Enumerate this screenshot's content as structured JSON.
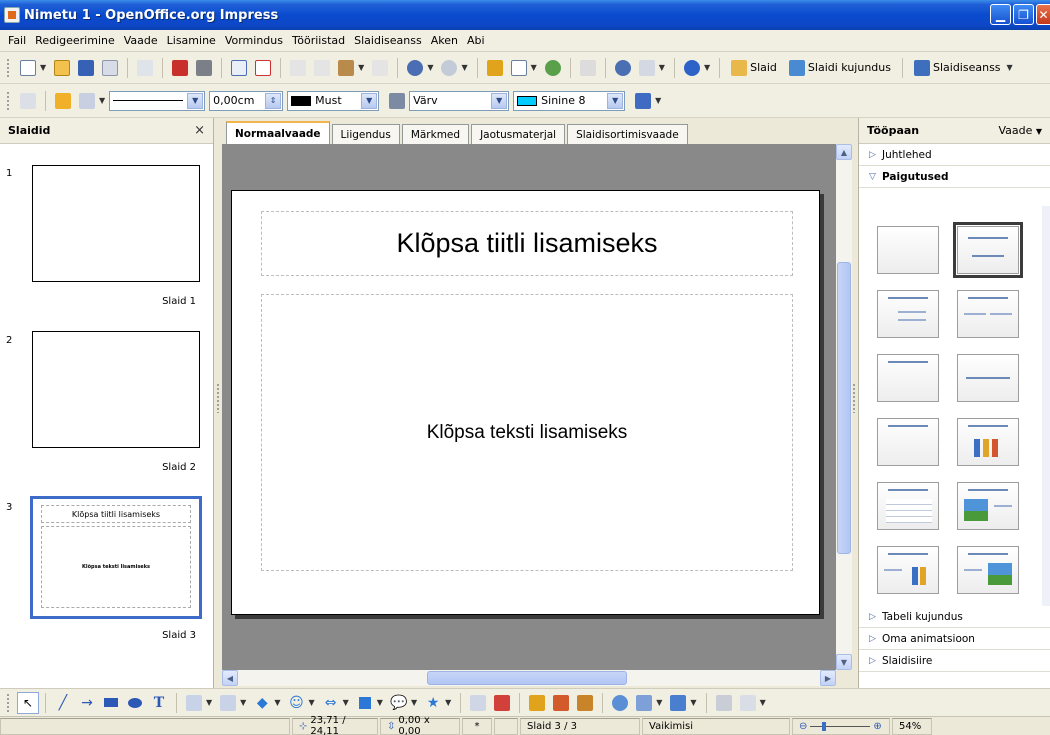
{
  "window": {
    "title": "Nimetu 1 - OpenOffice.org Impress"
  },
  "menu": [
    "Fail",
    "Redigeerimine",
    "Vaade",
    "Lisamine",
    "Vormindus",
    "Tööriistad",
    "Slaidiseanss",
    "Aken",
    "Abi"
  ],
  "toolbar1": {
    "slide_btn": "Slaid",
    "slide_design_btn": "Slaidi kujundus",
    "slideshow_btn": "Slaidiseanss"
  },
  "toolbar2": {
    "line_width": "0,00cm",
    "line_color": "Must",
    "fill_mode": "Värv",
    "fill_color": "Sinine 8",
    "colors": {
      "line": "#000000",
      "fill": "#00ccff"
    }
  },
  "slides_pane": {
    "title": "Slaidid",
    "close": "×",
    "items": [
      {
        "num": "1",
        "label": "Slaid 1"
      },
      {
        "num": "2",
        "label": "Slaid 2"
      },
      {
        "num": "3",
        "label": "Slaid 3",
        "title": "Klõpsa tiitli lisamiseks",
        "body": "Klõpsa teksti lisamiseks"
      }
    ]
  },
  "tabs": [
    "Normaalvaade",
    "Liigendus",
    "Märkmed",
    "Jaotusmaterjal",
    "Slaidisortimisvaade"
  ],
  "slide": {
    "title_placeholder": "Klõpsa tiitli lisamiseks",
    "body_placeholder": "Klõpsa teksti lisamiseks"
  },
  "task_pane": {
    "title": "Tööpaan",
    "view": "Vaade",
    "sections_top": [
      "Juhtlehed",
      "Paigutused"
    ],
    "sections_bottom": [
      "Tabeli kujundus",
      "Oma animatsioon",
      "Slaidisiire"
    ]
  },
  "status": {
    "position": "23,71 / 24,11",
    "size": "0,00 x 0,00",
    "modified": "*",
    "slide": "Slaid 3 / 3",
    "layout": "Vaikimisi",
    "zoom": "54%"
  }
}
